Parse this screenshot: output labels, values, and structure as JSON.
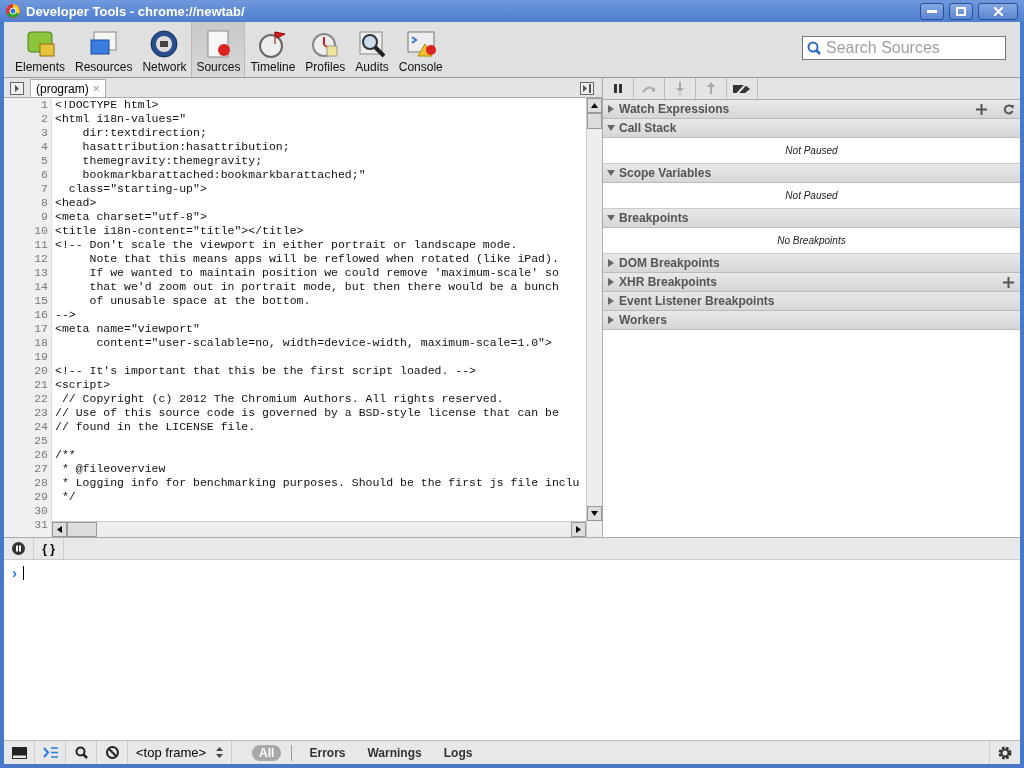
{
  "window": {
    "title": "Developer Tools - chrome://newtab/"
  },
  "tabs": [
    {
      "label": "Elements",
      "selected": false
    },
    {
      "label": "Resources",
      "selected": false
    },
    {
      "label": "Network",
      "selected": false
    },
    {
      "label": "Sources",
      "selected": true
    },
    {
      "label": "Timeline",
      "selected": false
    },
    {
      "label": "Profiles",
      "selected": false
    },
    {
      "label": "Audits",
      "selected": false
    },
    {
      "label": "Console",
      "selected": false
    }
  ],
  "search": {
    "placeholder": "Search Sources"
  },
  "editor": {
    "file_tab": "(program)",
    "close": "×",
    "lines": [
      {
        "number": "1",
        "text": "<!DOCTYPE html>"
      },
      {
        "number": "2",
        "text": "<html i18n-values=\""
      },
      {
        "number": "3",
        "text": "    dir:textdirection;"
      },
      {
        "number": "4",
        "text": "    hasattribution:hasattribution;"
      },
      {
        "number": "5",
        "text": "    themegravity:themegravity;"
      },
      {
        "number": "6",
        "text": "    bookmarkbarattached:bookmarkbarattached;\""
      },
      {
        "number": "7",
        "text": "  class=\"starting-up\">"
      },
      {
        "number": "8",
        "text": "<head>"
      },
      {
        "number": "9",
        "text": "<meta charset=\"utf-8\">"
      },
      {
        "number": "10",
        "text": "<title i18n-content=\"title\"></title>"
      },
      {
        "number": "11",
        "text": "<!-- Don't scale the viewport in either portrait or landscape mode."
      },
      {
        "number": "12",
        "text": "     Note that this means apps will be reflowed when rotated (like iPad)."
      },
      {
        "number": "13",
        "text": "     If we wanted to maintain position we could remove 'maximum-scale' so"
      },
      {
        "number": "14",
        "text": "     that we'd zoom out in portrait mode, but then there would be a bunch"
      },
      {
        "number": "15",
        "text": "     of unusable space at the bottom."
      },
      {
        "number": "16",
        "text": "-->"
      },
      {
        "number": "17",
        "text": "<meta name=\"viewport\""
      },
      {
        "number": "18",
        "text": "      content=\"user-scalable=no, width=device-width, maximum-scale=1.0\">"
      },
      {
        "number": "19"
      },
      {
        "number": "20",
        "text": "<!-- It's important that this be the first script loaded. -->"
      },
      {
        "number": "21",
        "text": "<script>"
      },
      {
        "number": "22",
        "text": " // Copyright (c) 2012 The Chromium Authors. All rights reserved."
      },
      {
        "number": "23",
        "text": "// Use of this source code is governed by a BSD-style license that can be"
      },
      {
        "number": "24",
        "text": "// found in the LICENSE file."
      },
      {
        "number": "25"
      },
      {
        "number": "26",
        "text": "/**"
      },
      {
        "number": "27",
        "text": " * @fileoverview"
      },
      {
        "number": "28",
        "text": " * Logging info for benchmarking purposes. Should be the first js file inclu"
      },
      {
        "number": "29",
        "text": " */"
      },
      {
        "number": "30"
      },
      {
        "number": "31"
      }
    ]
  },
  "debugger_buttons": [
    {
      "kind": "pause",
      "disabled": false
    },
    {
      "kind": "over",
      "disabled": true
    },
    {
      "kind": "into",
      "disabled": true
    },
    {
      "kind": "out",
      "disabled": true
    },
    {
      "kind": "deactivate",
      "disabled": false
    }
  ],
  "sidebar": {
    "sections": [
      {
        "title": "Watch Expressions",
        "expanded": false,
        "kind": "watch"
      },
      {
        "title": "Call Stack",
        "expanded": true,
        "message": "Not Paused",
        "kind": "plain"
      },
      {
        "title": "Scope Variables",
        "expanded": true,
        "message": "Not Paused",
        "kind": "plain"
      },
      {
        "title": "Breakpoints",
        "expanded": true,
        "message": "No Breakpoints",
        "kind": "plain"
      },
      {
        "title": "DOM Breakpoints",
        "expanded": false,
        "kind": "plain"
      },
      {
        "title": "XHR Breakpoints",
        "expanded": false,
        "kind": "xhr"
      },
      {
        "title": "Event Listener Breakpoints",
        "expanded": false,
        "kind": "plain"
      },
      {
        "title": "Workers",
        "expanded": false,
        "kind": "plain"
      }
    ]
  },
  "console": {
    "braces": "{ }",
    "prompt": "›"
  },
  "status_bar": {
    "frame": "<top frame>",
    "filters": [
      {
        "label": "All",
        "selected": true
      },
      {
        "label": "Errors",
        "selected": false
      },
      {
        "label": "Warnings",
        "selected": false
      },
      {
        "label": "Logs",
        "selected": false
      }
    ]
  }
}
